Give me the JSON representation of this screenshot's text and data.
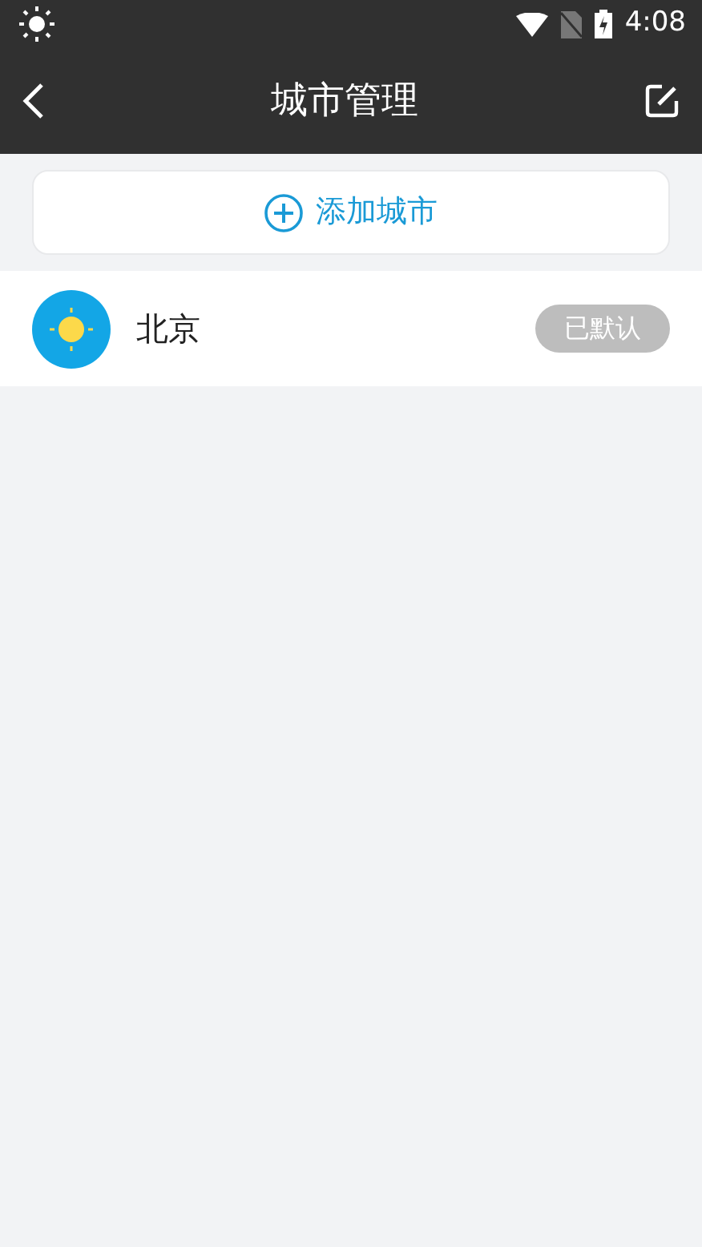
{
  "status_bar": {
    "time": "4:08"
  },
  "app_bar": {
    "title": "城市管理"
  },
  "add_button": {
    "label": "添加城市"
  },
  "cities": [
    {
      "name": "北京",
      "badge": "已默认",
      "default": true
    }
  ]
}
